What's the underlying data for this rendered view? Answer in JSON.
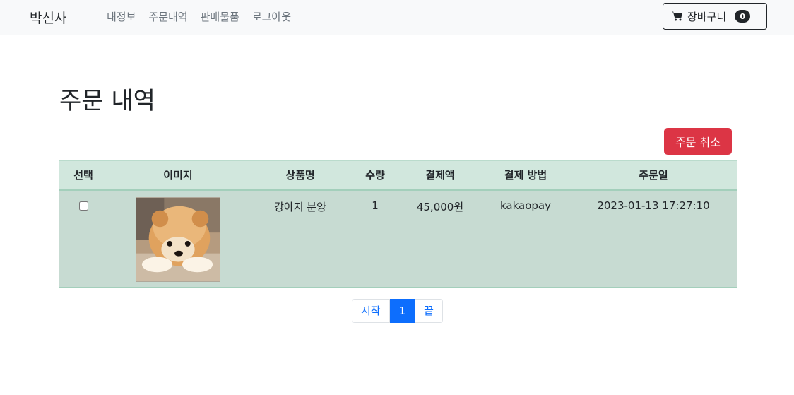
{
  "navbar": {
    "brand": "박신사",
    "links": [
      "내정보",
      "주문내역",
      "판매물품",
      "로그아웃"
    ],
    "cart_label": "장바구니",
    "cart_count": "0"
  },
  "page_title": "주문 내역",
  "cancel_button": "주문 취소",
  "table": {
    "headers": [
      "선택",
      "이미지",
      "상품명",
      "수량",
      "결제액",
      "결제 방법",
      "주문일"
    ],
    "rows": [
      {
        "product": "강아지 분양",
        "image_icon": "pomeranian-dog-photo",
        "quantity": "1",
        "amount": "45,000원",
        "method": "kakaopay",
        "date": "2023-01-13 17:27:10"
      }
    ]
  },
  "pagination": [
    "시작",
    "1",
    "끝"
  ],
  "colors": {
    "header_bg": "#d1e7dd",
    "row_bg": "#c7dbd2",
    "danger": "#dc3545",
    "primary": "#0d6efd"
  }
}
